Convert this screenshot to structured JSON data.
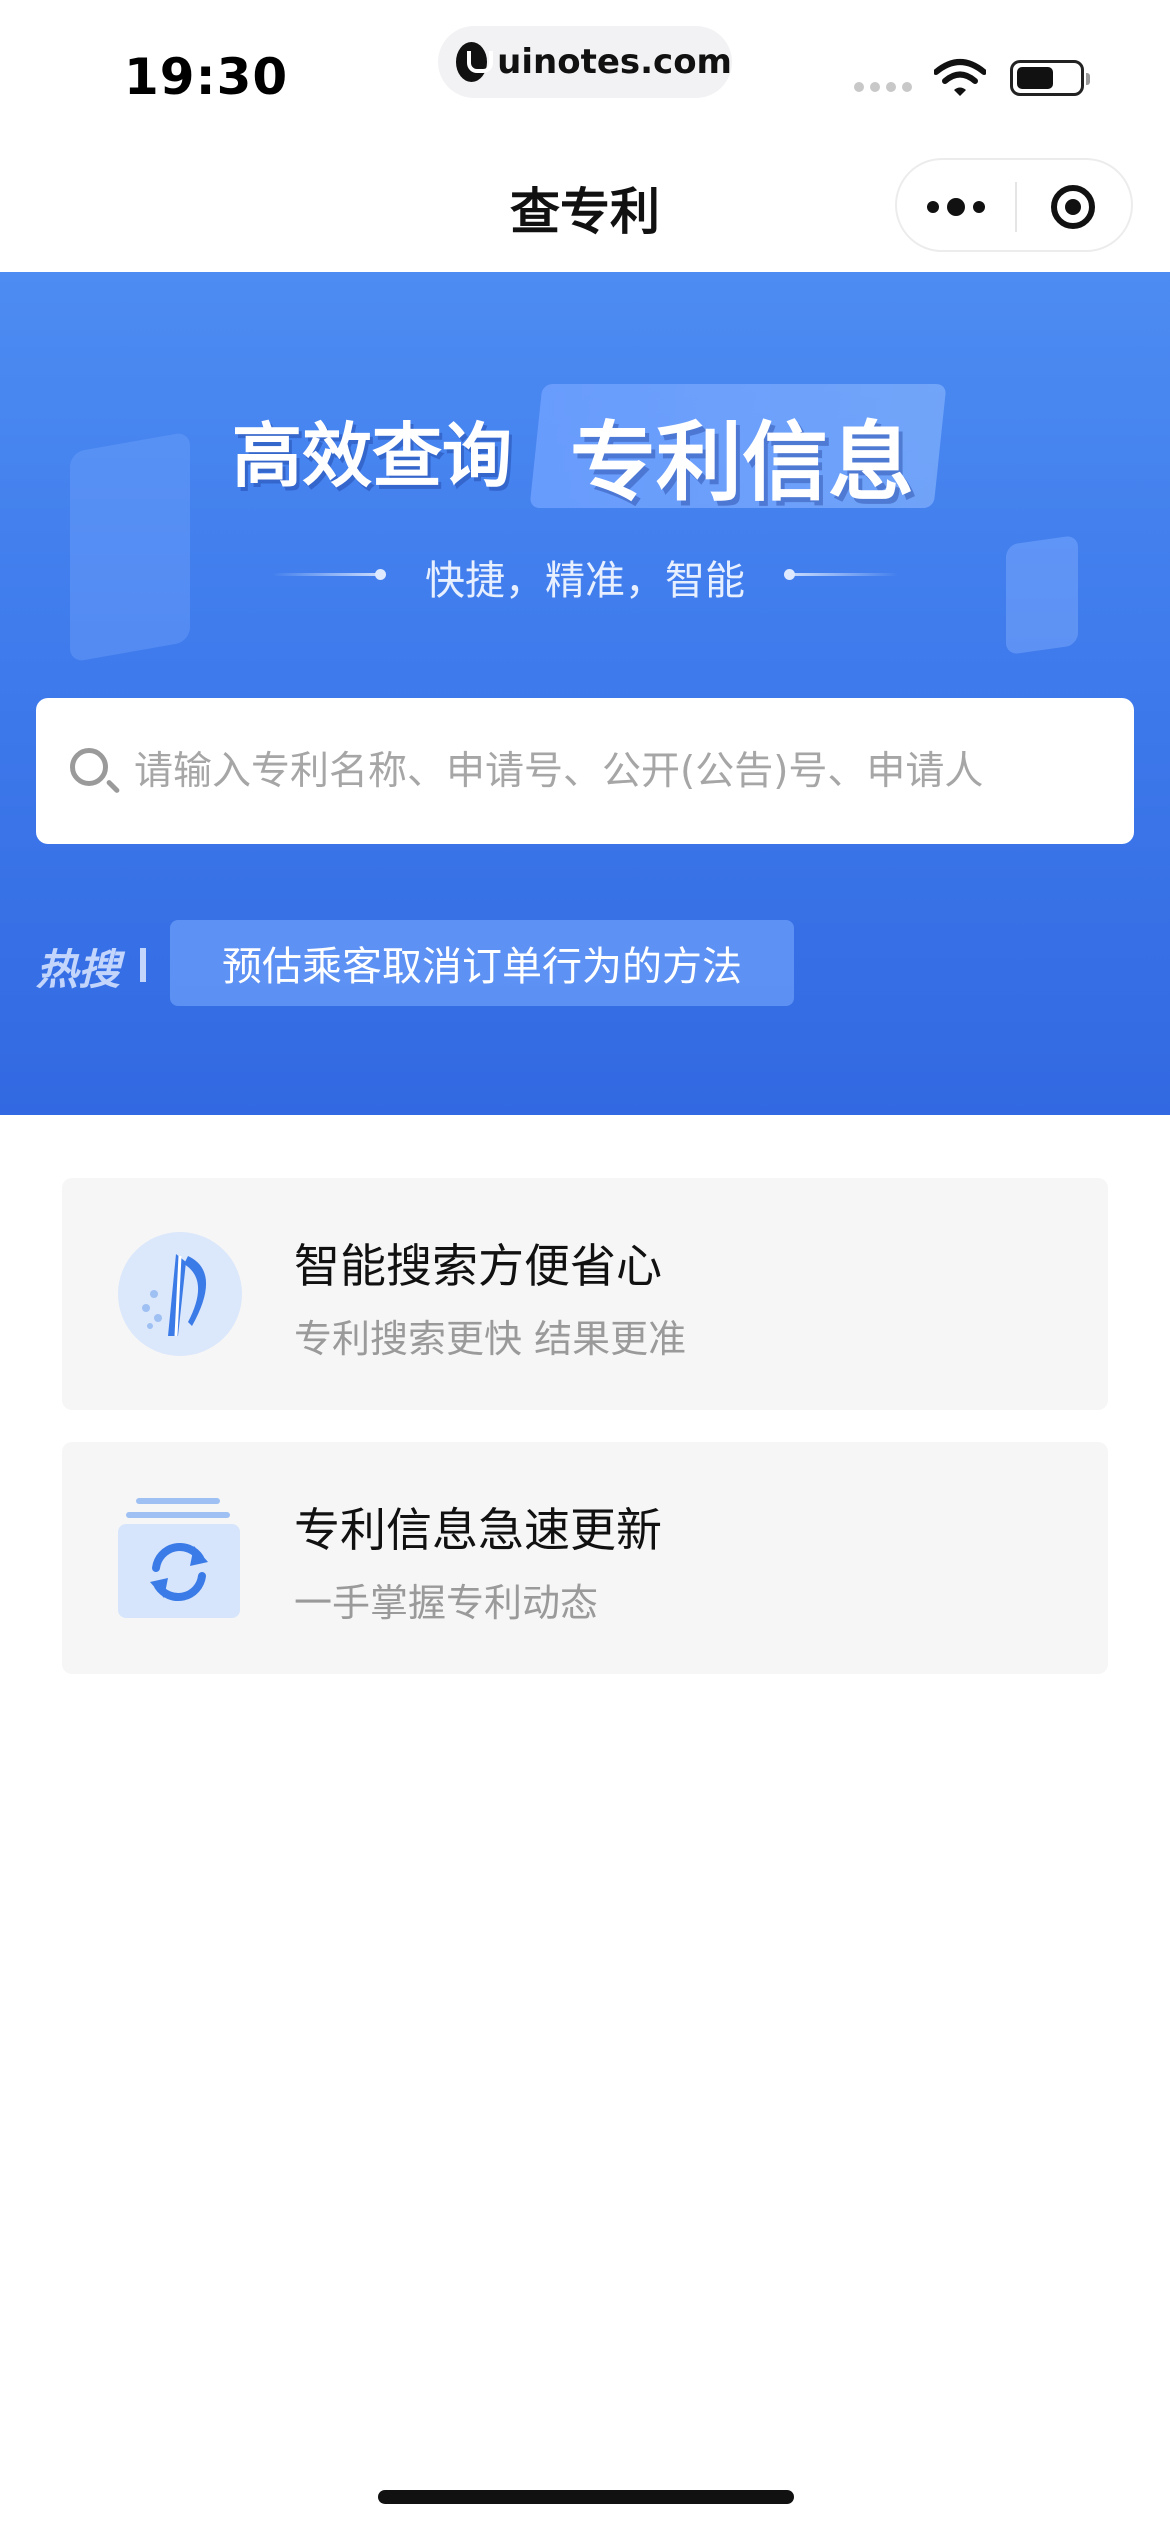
{
  "status_bar": {
    "time": "19:30",
    "url": "uinotes.com"
  },
  "nav": {
    "title": "查专利",
    "more_icon": "more-dots-icon",
    "close_icon": "target-icon"
  },
  "hero": {
    "title_left": "高效查询",
    "title_right": "专利信息",
    "tagline": "快捷，精准，智能",
    "search": {
      "placeholder": "请输入专利名称、申请号、公开(公告)号、申请人",
      "value": ""
    },
    "hot_label": "热搜",
    "hot_tag": "预估乘客取消订单行为的方法"
  },
  "features": [
    {
      "title": "智能搜索方便省心",
      "subtitle": "专利搜索更快 结果更准",
      "icon": "patent-logo-icon"
    },
    {
      "title": "专利信息急速更新",
      "subtitle": "一手掌握专利动态",
      "icon": "refresh-icon"
    }
  ],
  "colors": {
    "hero_top": "#4d8cf2",
    "hero_bottom": "#3269e2",
    "card_bg": "#f6f6f6",
    "icon_blue": "#3b7be8"
  }
}
